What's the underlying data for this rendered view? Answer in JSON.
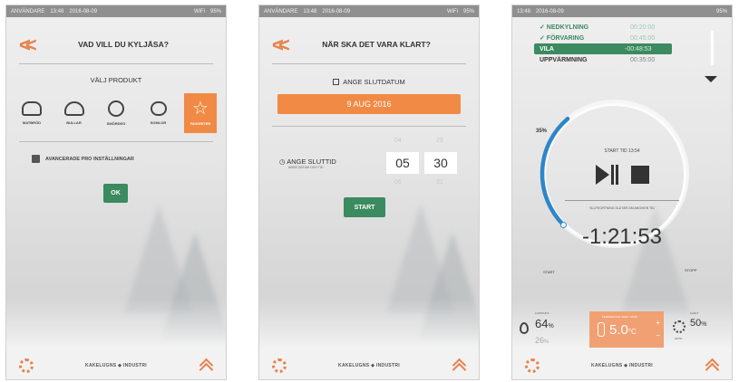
{
  "screens": [
    {
      "status": {
        "user": "ANVÄNDARE",
        "time": "13:48",
        "date": "2016-08-09",
        "wifi": "WiFi",
        "battery": "95%"
      },
      "title": "VAD VILL DU KYLJÄSA?",
      "subtitle": "VÄLJ PRODUKT",
      "products": [
        "MATBRÖD",
        "BULLAR",
        "SMÖRDEG",
        "SOMLOR",
        "FAVORITER"
      ],
      "advanced": "AVANCERADE PRO INSTÄLLNINGAR",
      "ok": "OK",
      "brand": "KAKELUGNS ◆ INDUSTRI"
    },
    {
      "status": {
        "user": "ANVÄNDARE",
        "time": "13:48",
        "date": "2016-08-09",
        "wifi": "WiFi",
        "battery": "95%"
      },
      "title": "NÄR SKA DET VARA KLART?",
      "date_label": "ANGE SLUTDATUM",
      "date_value": "9 AUG 2016",
      "time_label": "ANGE SLUTTID",
      "time_hint": "ANGE DATUM OCH TID",
      "hour": "05",
      "minute": "30",
      "hour_prev": "04",
      "minute_prev": "29",
      "hour_next": "06",
      "minute_next": "31",
      "start": "START",
      "brand": "KAKELUGNS ◆ INDUSTRI"
    },
    {
      "status": {
        "time": "13:48",
        "date": "2016-08-09",
        "battery": "95%"
      },
      "steps": [
        {
          "name": "✓ NEDKYLNING",
          "time": "00:20:00"
        },
        {
          "name": "✓ FÖRVARING",
          "time": "00:45:00"
        },
        {
          "name": "VILA",
          "time": "-00:48:53"
        },
        {
          "name": "UPPVÄRMNING",
          "time": "00:35:00"
        }
      ],
      "progress_pct": 35,
      "progress_label": "35%",
      "start_time": "START TID 13:54",
      "remaining_label": "SLUTKORTNING SLUTAR OM ANGIVEN TID",
      "countdown": "-1:21:53",
      "start_label": "START",
      "stop_label": "STOPP",
      "humidity_label": "LUFTFUKT.",
      "humidity": "64",
      "humidity_unit": "%",
      "humidity_set": "26",
      "humidity_set_unit": "%",
      "temperature_label": "TEMPERATUR INNE I SKÅP",
      "temperature": "5.0",
      "temperature_unit": "°C",
      "fan_label": "FLÄKT",
      "fan": "50",
      "fan_unit": "%",
      "fan_sub": "AUTO",
      "brand": "KAKELUGNS ◆ INDUSTRI"
    }
  ]
}
